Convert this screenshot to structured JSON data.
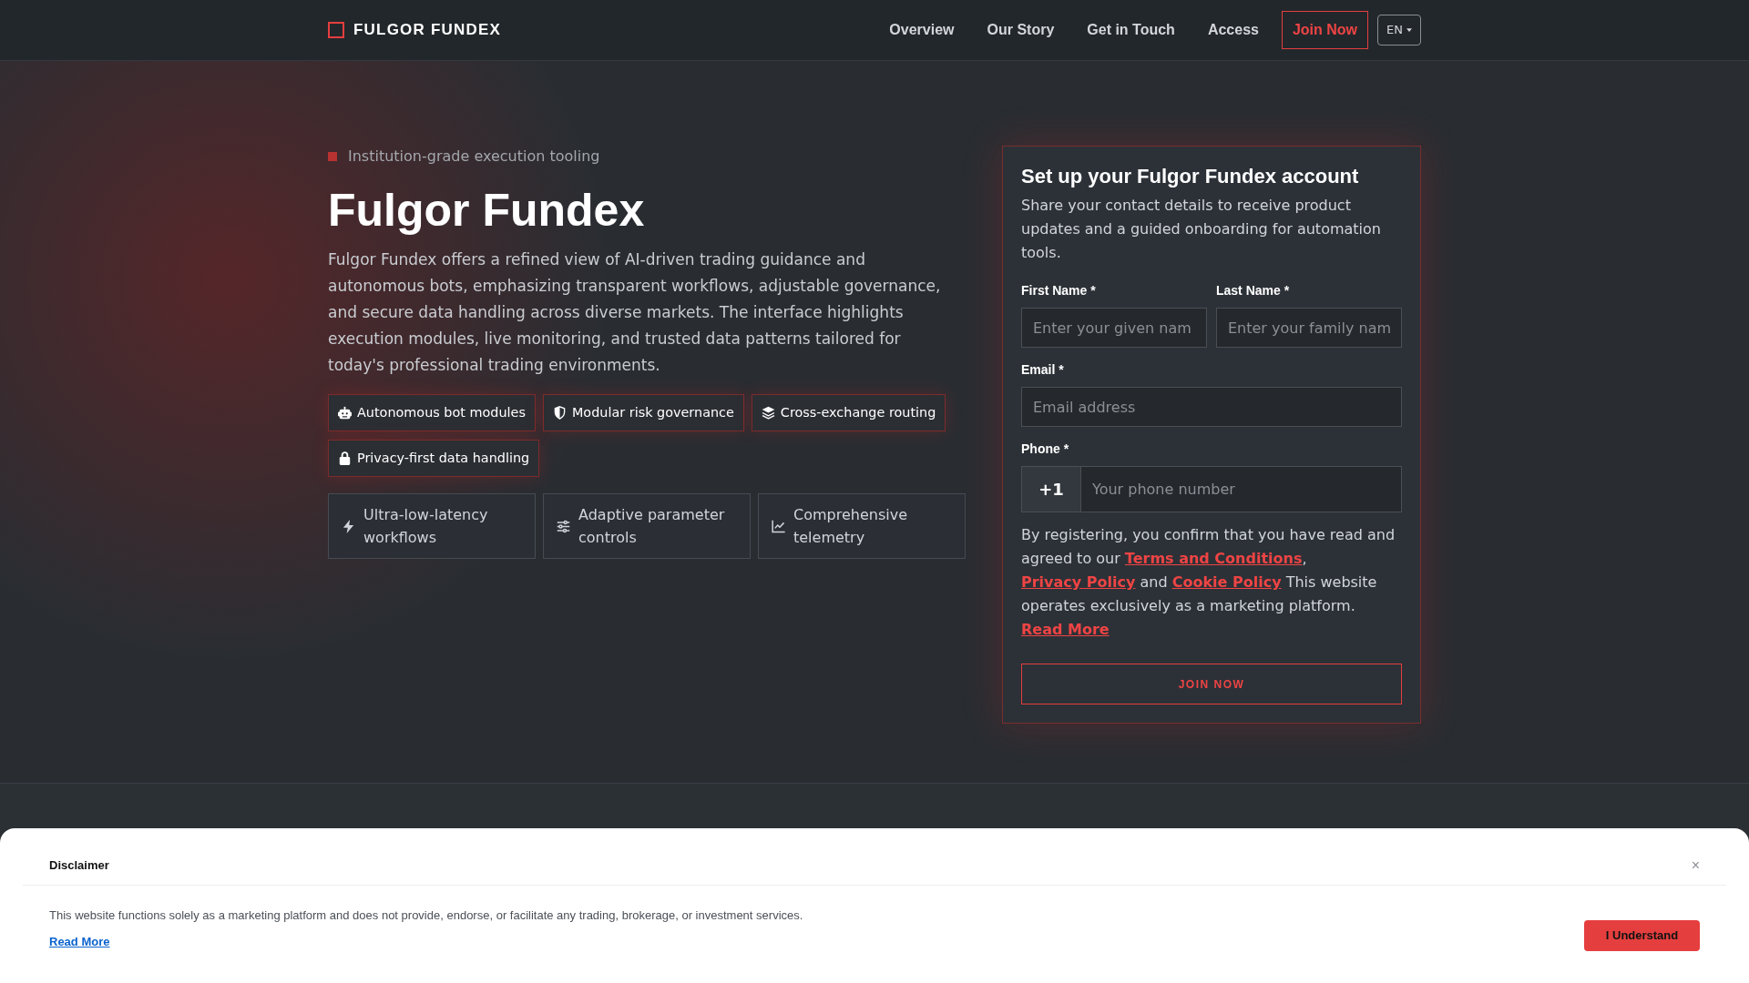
{
  "header": {
    "brand": "FULGOR FUNDEX",
    "nav": [
      "Overview",
      "Our Story",
      "Get in Touch",
      "Access"
    ],
    "cta": "Join Now",
    "language": "EN"
  },
  "hero": {
    "eyebrow": "Institution-grade execution tooling",
    "title": "Fulgor Fundex",
    "description": "Fulgor Fundex offers a refined view of AI-driven trading guidance and autonomous bots, emphasizing transparent workflows, adjustable governance, and secure data handling across diverse markets. The interface highlights execution modules, live monitoring, and trusted data patterns tailored for today's professional trading environments.",
    "tags": [
      "Autonomous bot modules",
      "Modular risk governance",
      "Cross-exchange routing",
      "Privacy-first data handling"
    ],
    "features": [
      "Ultra-low-latency workflows",
      "Adaptive parameter controls",
      "Comprehensive telemetry"
    ]
  },
  "signup_form": {
    "title": "Set up your Fulgor Fundex account",
    "description": "Share your contact details to receive product updates and a guided onboarding for automation tools.",
    "name_fields": [
      {
        "label": "First Name *",
        "placeholder": "Enter your given nam"
      },
      {
        "label": "Last Name *",
        "placeholder": "Enter your family nam"
      }
    ],
    "email": {
      "label": "Email *",
      "placeholder": "Email address"
    },
    "phone": {
      "label": "Phone *",
      "prefix": "+1",
      "placeholder": "Your phone number"
    },
    "consent": [
      {
        "kind": "text",
        "text": "By registering, you confirm that you have read and agreed to our "
      },
      {
        "kind": "link",
        "text": "Terms and Conditions"
      },
      {
        "kind": "text",
        "text": ", "
      },
      {
        "kind": "link",
        "text": "Privacy Policy"
      },
      {
        "kind": "text",
        "text": " and "
      },
      {
        "kind": "link",
        "text": "Cookie Policy"
      },
      {
        "kind": "text",
        "text": " This website operates exclusively as a marketing platform. "
      },
      {
        "kind": "link",
        "text": "Read More"
      }
    ],
    "submit": "JOIN NOW"
  },
  "disclaimer": {
    "title": "Disclaimer",
    "close": "×",
    "text": "This website functions solely as a marketing platform and does not provide, endorse, or facilitate any trading, brokerage, or investment services.",
    "link": "Read More",
    "button": "I Understand"
  }
}
